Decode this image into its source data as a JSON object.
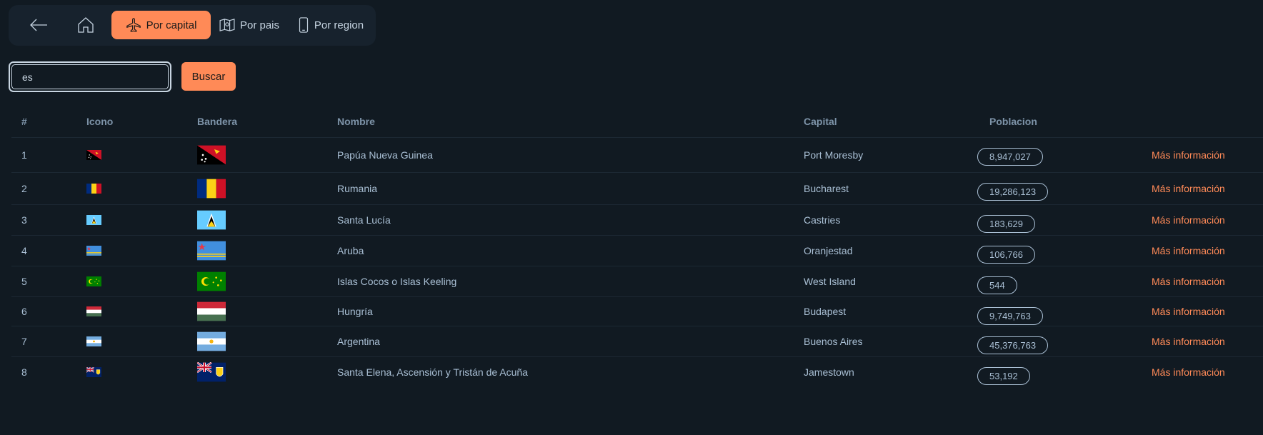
{
  "nav": {
    "back_icon": "arrow-left-icon",
    "home_icon": "home-icon",
    "items": [
      {
        "label": "Por capital",
        "icon": "plane-icon",
        "active": true
      },
      {
        "label": "Por pais",
        "icon": "map-icon",
        "active": false
      },
      {
        "label": "Por region",
        "icon": "phone-icon",
        "active": false
      }
    ]
  },
  "search": {
    "value": "es",
    "button_label": "Buscar"
  },
  "table": {
    "headers": [
      "#",
      "Icono",
      "Bandera",
      "Nombre",
      "Capital",
      "Poblacion"
    ],
    "rows": [
      {
        "num": "1",
        "flag": "papua-new-guinea",
        "name": "Papúa Nueva Guinea",
        "capital": "Port Moresby",
        "population": "8,947,027",
        "more": "Más información"
      },
      {
        "num": "2",
        "flag": "romania",
        "name": "Rumania",
        "capital": "Bucharest",
        "population": "19,286,123",
        "more": "Más información"
      },
      {
        "num": "3",
        "flag": "saint-lucia",
        "name": "Santa Lucía",
        "capital": "Castries",
        "population": "183,629",
        "more": "Más información"
      },
      {
        "num": "4",
        "flag": "aruba",
        "name": "Aruba",
        "capital": "Oranjestad",
        "population": "106,766",
        "more": "Más información"
      },
      {
        "num": "5",
        "flag": "cocos-islands",
        "name": "Islas Cocos o Islas Keeling",
        "capital": "West Island",
        "population": "544",
        "more": "Más información"
      },
      {
        "num": "6",
        "flag": "hungary",
        "name": "Hungría",
        "capital": "Budapest",
        "population": "9,749,763",
        "more": "Más información"
      },
      {
        "num": "7",
        "flag": "argentina",
        "name": "Argentina",
        "capital": "Buenos Aires",
        "population": "45,376,763",
        "more": "Más información"
      },
      {
        "num": "8",
        "flag": "saint-helena",
        "name": "Santa Elena, Ascensión y Tristán de Acuña",
        "capital": "Jamestown",
        "population": "53,192",
        "more": "Más información"
      }
    ]
  },
  "colors": {
    "background": "#111a22",
    "accent": "#ff8a57",
    "text": "#a9bfd4"
  }
}
